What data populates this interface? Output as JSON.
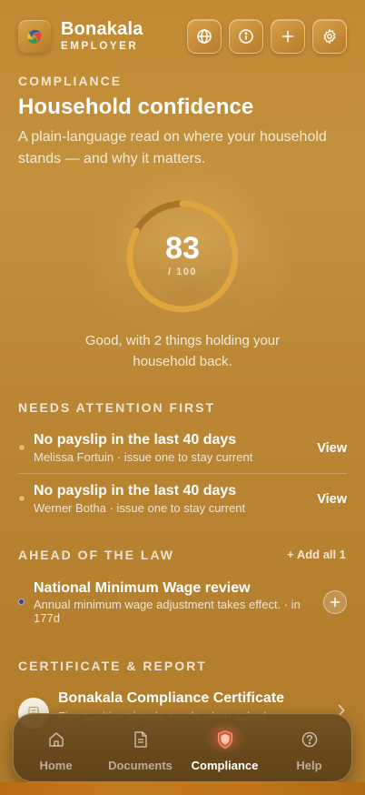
{
  "app": {
    "name": "Bonakala",
    "subtitle": "EMPLOYER"
  },
  "header": {
    "buttons": [
      {
        "name": "language",
        "icon": "globe-icon"
      },
      {
        "name": "info",
        "icon": "info-icon"
      },
      {
        "name": "add",
        "icon": "plus-icon"
      },
      {
        "name": "settings",
        "icon": "gear-icon"
      }
    ]
  },
  "page": {
    "eyebrow": "COMPLIANCE",
    "title": "Household confidence",
    "description": "A plain-language read on where your household stands — and why it matters."
  },
  "score": {
    "value": "83",
    "max_label": "/ 100",
    "fraction": 0.83,
    "caption": "Good, with 2 things holding your household back."
  },
  "needs_attention": {
    "heading": "NEEDS ATTENTION FIRST",
    "items": [
      {
        "title": "No payslip in the last 40 days",
        "subtitle": "Melissa Fortuin · issue one to stay current",
        "action": "View"
      },
      {
        "title": "No payslip in the last 40 days",
        "subtitle": "Werner Botha · issue one to stay current",
        "action": "View"
      }
    ]
  },
  "ahead": {
    "heading": "AHEAD OF THE LAW",
    "add_all": "+ Add all 1",
    "items": [
      {
        "title": "National Minimum Wage review",
        "subtitle_line1": "Annual minimum wage adjustment takes effect. · in",
        "subtitle_line2": "177d"
      }
    ]
  },
  "certificate": {
    "heading": "CERTIFICATE & REPORT",
    "title": "Bonakala Compliance Certificate",
    "subtitle": "Five positive signals, ready when asked"
  },
  "nav": {
    "items": [
      {
        "label": "Home",
        "icon": "home-icon"
      },
      {
        "label": "Documents",
        "icon": "document-icon"
      },
      {
        "label": "Compliance",
        "icon": "shield-icon",
        "active": true
      },
      {
        "label": "Help",
        "icon": "help-icon"
      }
    ]
  },
  "colors": {
    "accent_gold": "#e0a53f",
    "ring_track": "#9a6c22",
    "attention_dot": "#e8b860",
    "ahead_dot": "#4b3c8c",
    "active_glow": "#e66e46"
  }
}
